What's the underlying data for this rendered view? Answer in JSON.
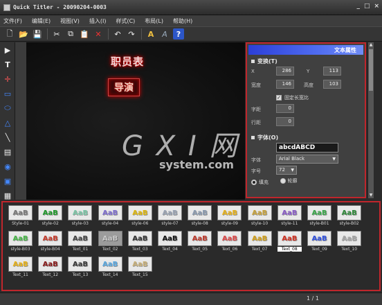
{
  "window": {
    "title": "Quick Titler - 20090204-0003",
    "buttons": [
      "_",
      "□",
      "×"
    ]
  },
  "menu": [
    "文件(F)",
    "编辑(E)",
    "视图(V)",
    "插入(I)",
    "样式(C)",
    "布局(L)",
    "帮助(H)"
  ],
  "toolbar": {
    "new": "🗋",
    "open": "📂",
    "save": "💾",
    "cut": "✂",
    "copy": "⧉",
    "paste": "📋",
    "delete": "✕",
    "undo": "↶",
    "redo": "↷",
    "font_a": "A",
    "font_b": "A",
    "help": "?"
  },
  "tools": [
    "▶",
    "T",
    "✛",
    "▭",
    "⬭",
    "△",
    "╲",
    "▤",
    "◉",
    "▣",
    "▦"
  ],
  "canvas": {
    "heading": "职员表",
    "boxed_text": "导演"
  },
  "watermark": {
    "line1": "G X I 网",
    "line2": "system.com"
  },
  "properties": {
    "title": "文本属性",
    "transform_label": "变换(T)",
    "x_label": "X",
    "x_value": "286",
    "y_label": "Y",
    "y_value": "113",
    "width_label": "宽度",
    "width_value": "146",
    "height_label": "高度",
    "height_value": "103",
    "aspect_label": "固定长宽比",
    "aspect_checked": "✓",
    "kerning_label": "字距",
    "kerning_value": "0",
    "leading_label": "行距",
    "leading_value": "0",
    "font_section_label": "字体(O)",
    "font_preview": "abcdABCD",
    "font_label": "字体",
    "font_value": "Arial Black",
    "size_label": "字号",
    "size_value": "72",
    "fill_label": "填充",
    "outline_label": "轮廓"
  },
  "styles": [
    {
      "label": "Style-01",
      "text": "AaB",
      "color": "#7a7a7a",
      "bg": "#e8e8e8"
    },
    {
      "label": "style-02",
      "text": "AaB",
      "color": "#1f9a2a",
      "bg": "#e8e8e8"
    },
    {
      "label": "style-03",
      "text": "AaB",
      "color": "#7cc7a8",
      "bg": "#e8e8e8"
    },
    {
      "label": "style-04",
      "text": "AaB",
      "color": "#7f6fd0",
      "bg": "#e8e8e8"
    },
    {
      "label": "style-06",
      "text": "AaB",
      "color": "#e0b80c",
      "bg": "#e8e8e8"
    },
    {
      "label": "style-07",
      "text": "AaB",
      "color": "#9aa4b4",
      "bg": "#e8e8e8"
    },
    {
      "label": "style-08",
      "text": "AaB",
      "color": "#8b9bb0",
      "bg": "#e8e8e8"
    },
    {
      "label": "style-09",
      "text": "AaB",
      "color": "#e8b218",
      "bg": "#e8e8e8"
    },
    {
      "label": "style-10",
      "text": "AaB",
      "color": "#c8a23a",
      "bg": "#e8e8e8"
    },
    {
      "label": "style-11",
      "text": "AaB",
      "color": "#8a5cc8",
      "bg": "#e8e8e8"
    },
    {
      "label": "style-B01",
      "text": "AaB",
      "color": "#3aa84a",
      "bg": "#e8e8e8"
    },
    {
      "label": "style-B02",
      "text": "AaB",
      "color": "#2f8a3a",
      "bg": "#e8e8e8"
    },
    {
      "label": "style-B03",
      "text": "AaB",
      "color": "#48b848",
      "bg": "#e8e8e8"
    },
    {
      "label": "style-B04",
      "text": "AaB",
      "color": "#c83a2a",
      "bg": "#e8e8e8"
    },
    {
      "label": "Text_01",
      "text": "AaB",
      "color": "#444444",
      "bg": "#e8e8e8"
    },
    {
      "label": "Text_02",
      "text": "AaB",
      "color": "#cccccc",
      "bg": "#9c9c9c"
    },
    {
      "label": "Text_03",
      "text": "AaB",
      "color": "#333333",
      "bg": "#e8e8e8"
    },
    {
      "label": "Text_04",
      "text": "AaB",
      "color": "#111111",
      "bg": "#e8e8e8"
    },
    {
      "label": "Text_05",
      "text": "AaB",
      "color": "#c0392b",
      "bg": "#e8e8e8"
    },
    {
      "label": "Text_06",
      "text": "AaB",
      "color": "#e04848",
      "bg": "#e8e8e8"
    },
    {
      "label": "Text_07",
      "text": "AaB",
      "color": "#d4a018",
      "bg": "#e8e8e8"
    },
    {
      "label": "Text_08",
      "text": "AaB",
      "color": "#d23020",
      "bg": "#e8e8e8"
    },
    {
      "label": "Text_09",
      "text": "AaB",
      "color": "#2f50e0",
      "bg": "#e8e8e8"
    },
    {
      "label": "Text_10",
      "text": "AaB",
      "color": "#a8a8a8",
      "bg": "#e8e8e8"
    },
    {
      "label": "Text_11",
      "text": "AaB",
      "color": "#e8b218",
      "bg": "#e8e8e8"
    },
    {
      "label": "Text_12",
      "text": "AaB",
      "color": "#8a1a1a",
      "bg": "#e8e8e8"
    },
    {
      "label": "Text_13",
      "text": "AaB",
      "color": "#3a3a3a",
      "bg": "#e8e8e8"
    },
    {
      "label": "Text_14",
      "text": "AaB",
      "color": "#5aa8e0",
      "bg": "#e8e8e8"
    },
    {
      "label": "Text_15",
      "text": "AaB",
      "color": "#c8b078",
      "bg": "#e8e8e8"
    }
  ],
  "selected_style": "Text_08",
  "status": {
    "page": "1 / 1"
  }
}
